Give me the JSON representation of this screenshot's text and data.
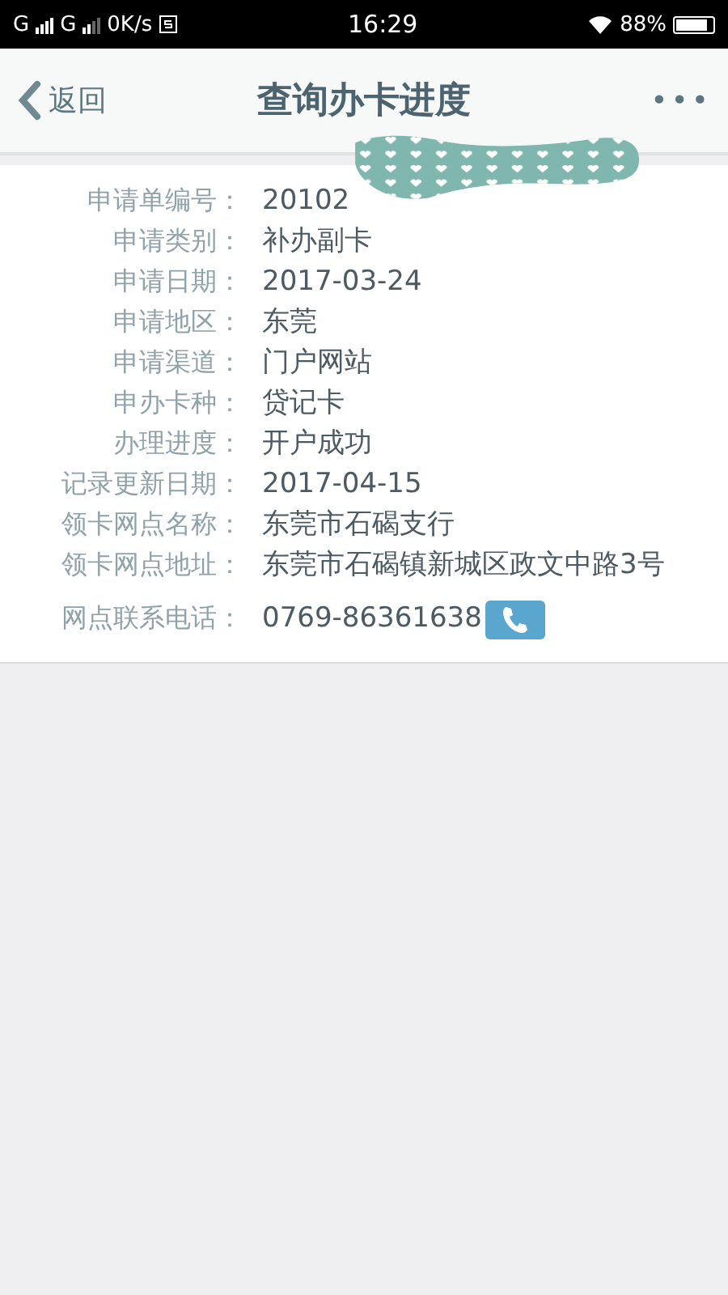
{
  "status_bar": {
    "sim1": "G",
    "sim2": "G",
    "speed": "0K/s",
    "time": "16:29",
    "battery": "88%"
  },
  "nav_bar": {
    "back": "返回",
    "title": "查询办卡进度",
    "more": "•••"
  },
  "fields": [
    {
      "label": "申请单编号：",
      "value": "20102"
    },
    {
      "label": "申请类别：",
      "value": "补办副卡"
    },
    {
      "label": "申请日期：",
      "value": "2017-03-24"
    },
    {
      "label": "申请地区：",
      "value": "东莞"
    },
    {
      "label": "申请渠道：",
      "value": "门户网站"
    },
    {
      "label": "申办卡种：",
      "value": "贷记卡"
    },
    {
      "label": "办理进度：",
      "value": "开户成功"
    },
    {
      "label": "记录更新日期：",
      "value": "2017-04-15"
    },
    {
      "label": "领卡网点名称：",
      "value": "东莞市石碣支行"
    },
    {
      "label": "领卡网点地址：",
      "value": "东莞市石碣镇新城区政文中路3号"
    },
    {
      "label": "网点联系电话：",
      "value": "0769-86361638",
      "kind": "phone"
    }
  ]
}
